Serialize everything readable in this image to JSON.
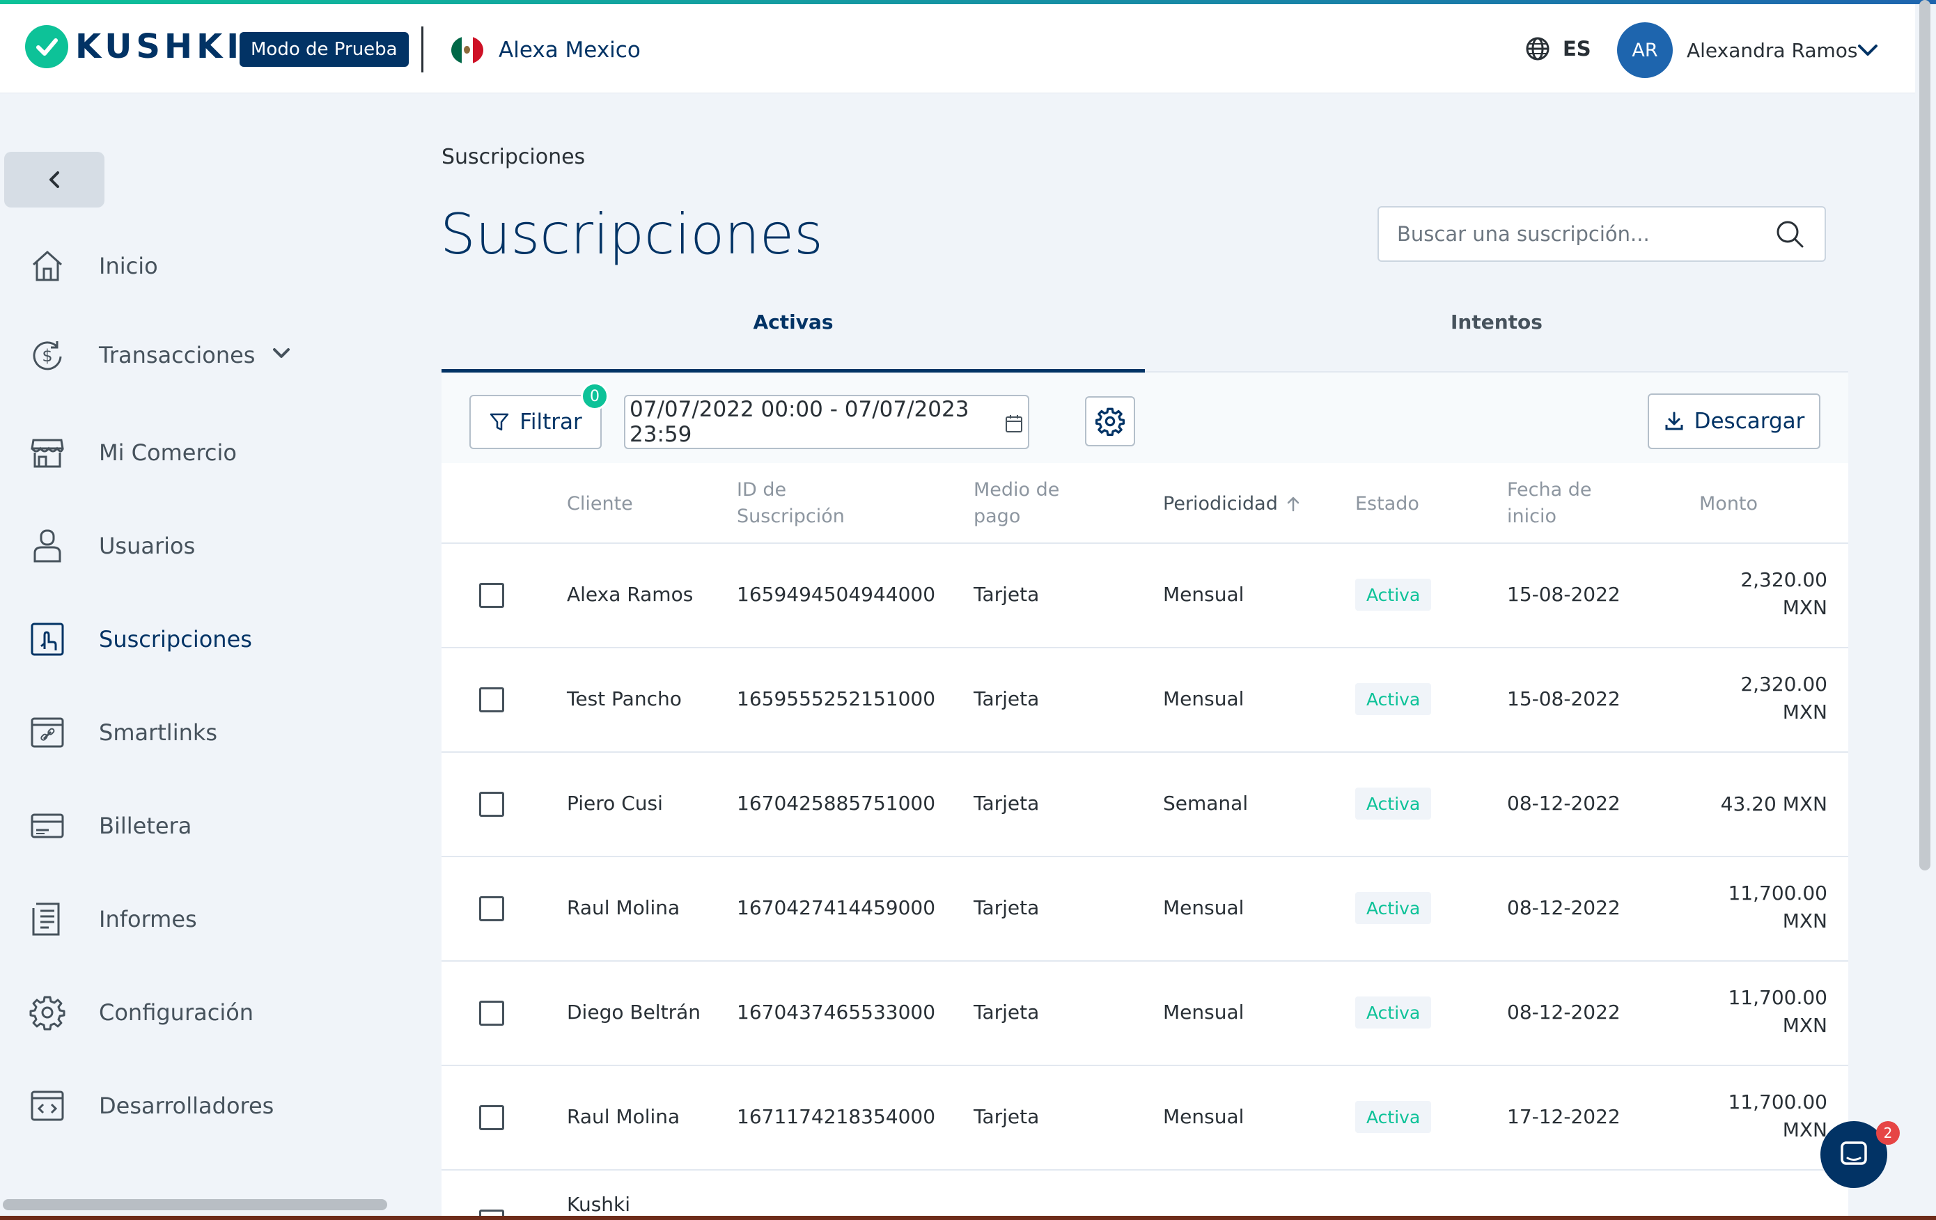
{
  "brand": {
    "logo_text": "KUSHKI",
    "mode_badge": "Modo de Prueba",
    "merchant_name": "Alexa Mexico",
    "accent": "#0DC298",
    "primary": "#023365"
  },
  "header": {
    "language": "ES",
    "user_initials": "AR",
    "user_name": "Alexandra Ramos"
  },
  "sidebar": {
    "items": [
      {
        "label": "Inicio",
        "icon": "home-icon"
      },
      {
        "label": "Transacciones",
        "icon": "dollar-cycle-icon"
      },
      {
        "label": "Mi Comercio",
        "icon": "store-icon"
      },
      {
        "label": "Usuarios",
        "icon": "user-icon"
      },
      {
        "label": "Suscripciones",
        "icon": "touch-icon"
      },
      {
        "label": "Smartlinks",
        "icon": "link-card-icon"
      },
      {
        "label": "Billetera",
        "icon": "card-icon"
      },
      {
        "label": "Informes",
        "icon": "report-icon"
      },
      {
        "label": "Configuración",
        "icon": "gear-icon"
      },
      {
        "label": "Desarrolladores",
        "icon": "code-icon"
      }
    ]
  },
  "page": {
    "breadcrumb": "Suscripciones",
    "title": "Suscripciones",
    "search_placeholder": "Buscar una suscripción..."
  },
  "tabs": [
    {
      "label": "Activas"
    },
    {
      "label": "Intentos"
    }
  ],
  "toolbar": {
    "filter_label": "Filtrar",
    "filter_count": "0",
    "date_range": "07/07/2022 00:00 - 07/07/2023 23:59",
    "download_label": "Descargar"
  },
  "table": {
    "headers": {
      "cliente": "Cliente",
      "id_1": "ID de",
      "id_2": "Suscripción",
      "medio_1": "Medio de",
      "medio_2": "pago",
      "periodicidad": "Periodicidad",
      "estado": "Estado",
      "fecha_1": "Fecha de",
      "fecha_2": "inicio",
      "monto": "Monto"
    },
    "rows": [
      {
        "cliente": "Alexa Ramos",
        "id": "1659494504944000",
        "medio": "Tarjeta",
        "periodicidad": "Mensual",
        "estado": "Activa",
        "fecha": "15-08-2022",
        "monto": "2,320.00\nMXN"
      },
      {
        "cliente": "Test Pancho",
        "id": "1659555252151000",
        "medio": "Tarjeta",
        "periodicidad": "Mensual",
        "estado": "Activa",
        "fecha": "15-08-2022",
        "monto": "2,320.00\nMXN"
      },
      {
        "cliente": "Piero Cusi",
        "id": "1670425885751000",
        "medio": "Tarjeta",
        "periodicidad": "Semanal",
        "estado": "Activa",
        "fecha": "08-12-2022",
        "monto": "43.20 MXN"
      },
      {
        "cliente": "Raul Molina",
        "id": "1670427414459000",
        "medio": "Tarjeta",
        "periodicidad": "Mensual",
        "estado": "Activa",
        "fecha": "08-12-2022",
        "monto": "11,700.00\nMXN"
      },
      {
        "cliente": "Diego Beltrán",
        "id": "1670437465533000",
        "medio": "Tarjeta",
        "periodicidad": "Mensual",
        "estado": "Activa",
        "fecha": "08-12-2022",
        "monto": "11,700.00\nMXN"
      },
      {
        "cliente": "Raul Molina",
        "id": "1671174218354000",
        "medio": "Tarjeta",
        "periodicidad": "Mensual",
        "estado": "Activa",
        "fecha": "17-12-2022",
        "monto": "11,700.00\nMXN"
      },
      {
        "cliente": "Kushki",
        "id": "",
        "medio": "",
        "periodicidad": "",
        "estado": "",
        "fecha": "",
        "monto": ""
      }
    ]
  },
  "chat": {
    "badge_count": "2"
  }
}
